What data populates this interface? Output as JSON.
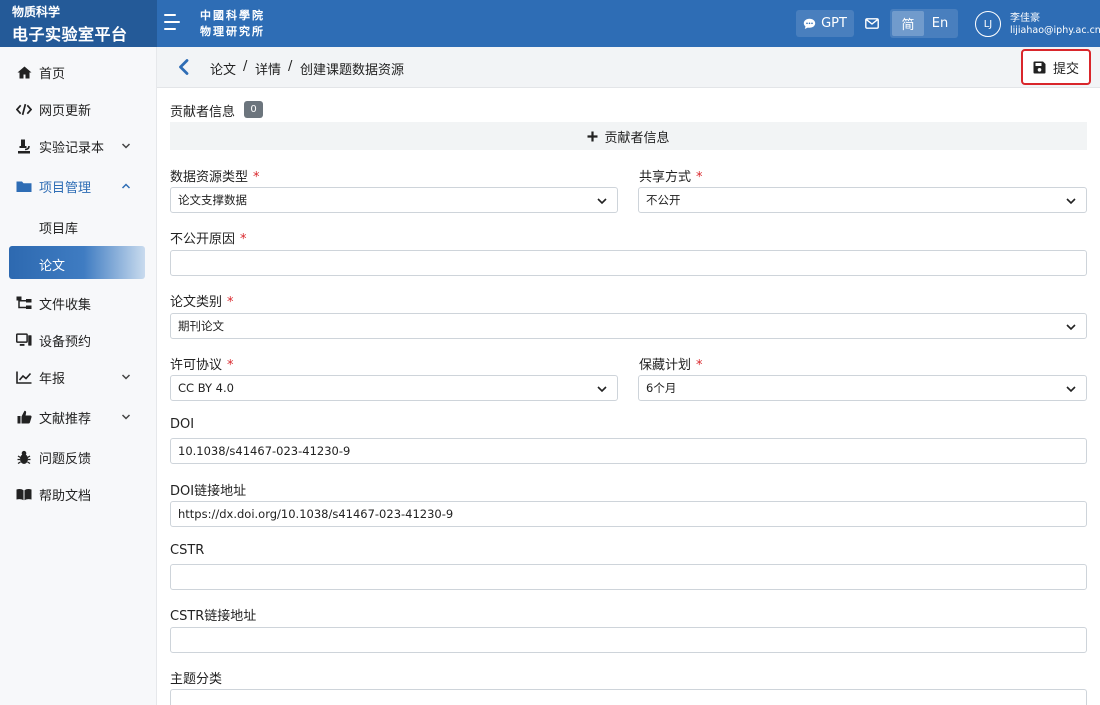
{
  "brand": {
    "subtitle": "物质科学",
    "title": "电子实验室平台"
  },
  "institute": {
    "line1": "中國科學院",
    "line2": "物理研究所"
  },
  "header": {
    "gpt_label": "GPT",
    "lang_zh": "简",
    "lang_en": "En",
    "avatar_initials": "LJ",
    "user_name": "李佳豪",
    "user_email": "lijiahao@iphy.ac.cn"
  },
  "sidebar": {
    "items": [
      {
        "label": "首页",
        "icon": "home-icon"
      },
      {
        "label": "网页更新",
        "icon": "code-icon"
      },
      {
        "label": "实验记录本",
        "icon": "microscope-icon"
      },
      {
        "label": "项目管理",
        "icon": "folder-icon"
      },
      {
        "label": "项目库"
      },
      {
        "label": "论文"
      },
      {
        "label": "文件收集",
        "icon": "sitemap-icon"
      },
      {
        "label": "设备预约",
        "icon": "desktop-icon"
      },
      {
        "label": "年报",
        "icon": "chart-line-icon"
      },
      {
        "label": "文献推荐",
        "icon": "thumbs-up-icon"
      },
      {
        "label": "问题反馈",
        "icon": "bug-icon"
      },
      {
        "label": "帮助文档",
        "icon": "book-icon"
      }
    ]
  },
  "breadcrumb": {
    "items": [
      "论文",
      "详情",
      "创建课题数据资源"
    ],
    "separator": "/"
  },
  "toolbar": {
    "submit_label": "提交"
  },
  "form": {
    "contributors": {
      "label": "贡献者信息",
      "count": "0",
      "add_label": "贡献者信息"
    },
    "resource_type": {
      "label": "数据资源类型",
      "value": "论文支撑数据"
    },
    "share_mode": {
      "label": "共享方式",
      "value": "不公开"
    },
    "private_reason": {
      "label": "不公开原因",
      "value": ""
    },
    "paper_category": {
      "label": "论文类别",
      "value": "期刊论文"
    },
    "license": {
      "label": "许可协议",
      "value": "CC BY 4.0"
    },
    "embargo": {
      "label": "保藏计划",
      "value": "6个月"
    },
    "doi": {
      "label": "DOI",
      "value": "10.1038/s41467-023-41230-9"
    },
    "doi_url": {
      "label": "DOI链接地址",
      "value": "https://dx.doi.org/10.1038/s41467-023-41230-9"
    },
    "cstr": {
      "label": "CSTR",
      "value": ""
    },
    "cstr_url": {
      "label": "CSTR链接地址",
      "value": ""
    },
    "subject": {
      "label": "主题分类",
      "value": ""
    },
    "required_mark": "*"
  },
  "colors": {
    "primary": "#2e6db5",
    "brand_dark": "#245a98",
    "required": "#d9262b",
    "highlight_border": "#d9262b"
  }
}
